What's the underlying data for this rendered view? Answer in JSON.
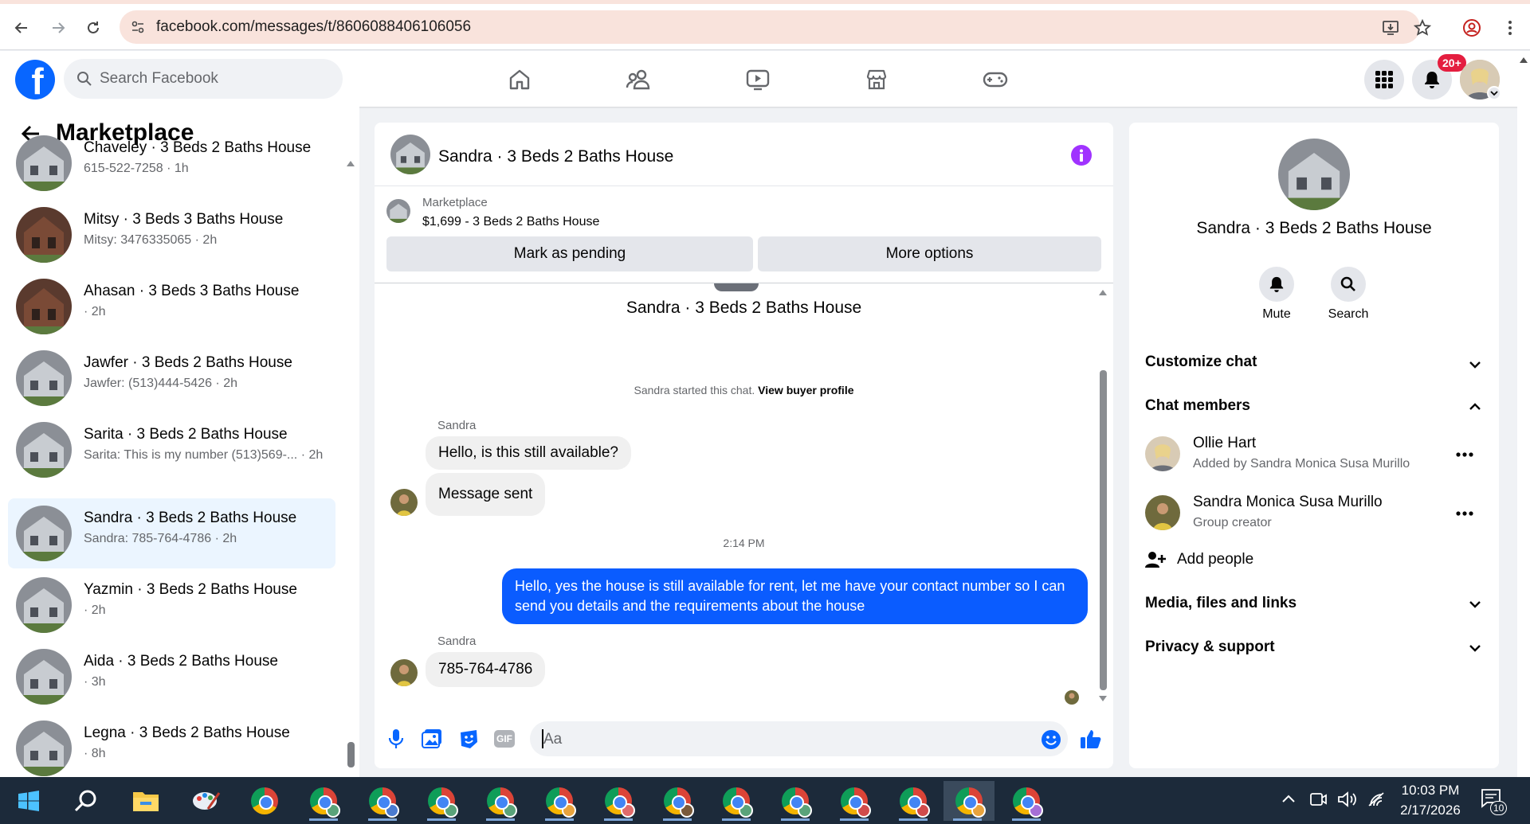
{
  "browser": {
    "url": "facebook.com/messages/t/8606088406106056"
  },
  "header": {
    "search_placeholder": "Search Facebook",
    "notification_badge": "20+",
    "nav_icons": [
      "home-icon",
      "friends-icon",
      "video-icon",
      "marketplace-icon",
      "gaming-icon"
    ]
  },
  "sidebar": {
    "title": "Marketplace",
    "conversations": [
      {
        "title": "Chaveley · 3 Beds 2 Baths House",
        "subtitle": "615-522-7258 · 1h",
        "active": false
      },
      {
        "title": "Mitsy · 3 Beds 3 Baths House",
        "subtitle": "Mitsy: 3476335065 · 2h",
        "active": false
      },
      {
        "title": "Ahasan · 3 Beds 3 Baths House",
        "subtitle": "· 2h",
        "active": false
      },
      {
        "title": "Jawfer · 3 Beds 2 Baths House",
        "subtitle": "Jawfer: (513)444-5426 · 2h",
        "active": false
      },
      {
        "title": "Sarita · 3 Beds 2 Baths House",
        "subtitle": "Sarita: This is my number (513)569-... · 2h",
        "active": false
      },
      {
        "title": "Sandra · 3 Beds 2 Baths House",
        "subtitle": "Sandra: 785-764-4786 · 2h",
        "active": true
      },
      {
        "title": "Yazmin · 3 Beds 2 Baths House",
        "subtitle": "· 2h",
        "active": false
      },
      {
        "title": "Aida · 3 Beds 2 Baths House",
        "subtitle": "· 3h",
        "active": false
      },
      {
        "title": "Legna · 3 Beds 2 Baths House",
        "subtitle": "· 8h",
        "active": false
      }
    ]
  },
  "chat": {
    "title": "Sandra · 3 Beds 2 Baths House",
    "marketplace_label": "Marketplace",
    "listing": "$1,699 - 3 Beds 2 Baths House",
    "mark_pending": "Mark as pending",
    "more_options": "More options",
    "thread_title": "Sandra · 3 Beds 2 Baths House",
    "started_text": "Sandra started this chat.",
    "view_profile": "View buyer profile",
    "sender1": "Sandra",
    "msg1": "Hello, is this still available?",
    "msg2": "Message sent",
    "timestamp": "2:14 PM",
    "reply": "Hello, yes the house is still available for rent, let me have your contact number so I can send you details and the requirements about the house",
    "sender2": "Sandra",
    "msg3": "785-764-4786",
    "composer_placeholder": "Aa"
  },
  "details": {
    "title": "Sandra · 3 Beds 2 Baths House",
    "mute": "Mute",
    "search": "Search",
    "customize": "Customize chat",
    "members_header": "Chat members",
    "members": [
      {
        "name": "Ollie Hart",
        "role": "Added by Sandra Monica Susa Murillo"
      },
      {
        "name": "Sandra Monica Susa Murillo",
        "role": "Group creator"
      }
    ],
    "add_people": "Add people",
    "media": "Media, files and links",
    "privacy": "Privacy & support"
  },
  "taskbar": {
    "time": "10:03 PM",
    "date": "2/17/2026",
    "notifications": "10"
  },
  "colors": {
    "fb_blue": "#0866ff",
    "outgoing_bubble": "#0a5cff",
    "active_row": "#ebf5ff",
    "info_purple": "#a033ff"
  }
}
